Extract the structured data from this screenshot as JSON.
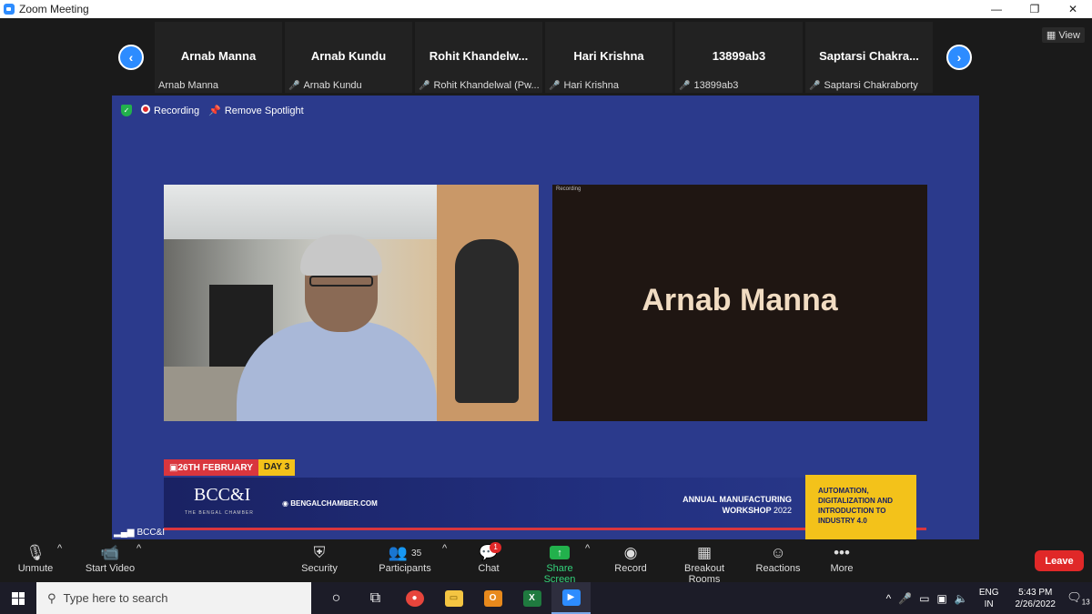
{
  "window": {
    "title": "Zoom Meeting",
    "minimize": "—",
    "restore": "❐",
    "close": "✕"
  },
  "strip": {
    "prev": "‹",
    "next": "›",
    "view_label": "View",
    "participants": [
      {
        "name": "Arnab Manna",
        "label": "Arnab Manna",
        "muted": false
      },
      {
        "name": "Arnab Kundu",
        "label": "Arnab Kundu",
        "muted": true
      },
      {
        "name": "Rohit  Khandelw...",
        "label": "Rohit Khandelwal (Pw...",
        "muted": true
      },
      {
        "name": "Hari Krishna",
        "label": "Hari Krishna",
        "muted": true
      },
      {
        "name": "13899ab3",
        "label": "13899ab3",
        "muted": true
      },
      {
        "name": "Saptarsi  Chakra...",
        "label": "Saptarsi Chakraborty",
        "muted": true
      }
    ]
  },
  "stage": {
    "recording_label": "Recording",
    "remove_spotlight_label": "Remove Spotlight",
    "speaker_name_tile": "Arnab Manna",
    "rec_tag": "Recording",
    "footer_label": "BCC&I"
  },
  "banner": {
    "date": "26TH FEBRUARY",
    "day": "DAY 3",
    "logo": "BCC&I",
    "logo_sub": "THE BENGAL CHAMBER",
    "url": "BENGALCHAMBER.COM",
    "workshop_line1": "ANNUAL MANUFACTURING",
    "workshop_line2": "WORKSHOP",
    "workshop_year": "2022",
    "theme": "AUTOMATION, DIGITALIZATION AND INTRODUCTION TO INDUSTRY 4.0"
  },
  "toolbar": {
    "unmute": "Unmute",
    "start_video": "Start Video",
    "security": "Security",
    "participants": "Participants",
    "participants_count": "35",
    "chat": "Chat",
    "chat_badge": "1",
    "share_screen": "Share Screen",
    "record": "Record",
    "breakout_rooms": "Breakout Rooms",
    "reactions": "Reactions",
    "more": "More",
    "leave": "Leave"
  },
  "taskbar": {
    "search_placeholder": "Type here to search",
    "lang_line1": "ENG",
    "lang_line2": "IN",
    "time": "5:43 PM",
    "date": "2/26/2022",
    "notif_count": "13"
  },
  "colors": {
    "accent": "#2d8cff",
    "stage_bg": "#2b3a8c",
    "leave": "#e02828",
    "share": "#22b14c"
  }
}
